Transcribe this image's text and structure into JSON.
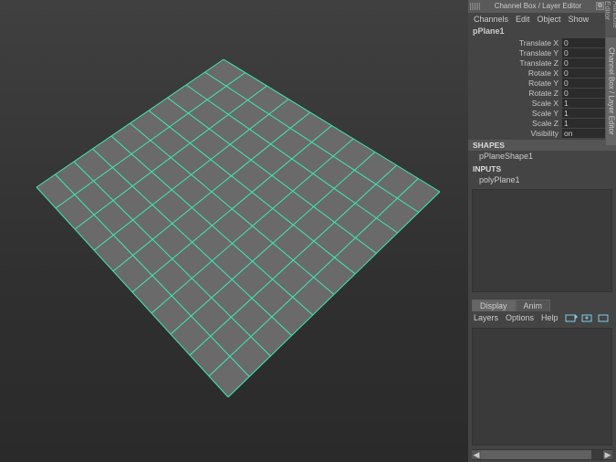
{
  "panel_title": "Channel Box / Layer Editor",
  "menus": {
    "channels": "Channels",
    "edit": "Edit",
    "object": "Object",
    "show": "Show"
  },
  "object_name": "pPlane1",
  "attrs": {
    "tx": {
      "label": "Translate X",
      "value": "0"
    },
    "ty": {
      "label": "Translate Y",
      "value": "0"
    },
    "tz": {
      "label": "Translate Z",
      "value": "0"
    },
    "rx": {
      "label": "Rotate X",
      "value": "0"
    },
    "ry": {
      "label": "Rotate Y",
      "value": "0"
    },
    "rz": {
      "label": "Rotate Z",
      "value": "0"
    },
    "sx": {
      "label": "Scale X",
      "value": "1"
    },
    "sy": {
      "label": "Scale Y",
      "value": "1"
    },
    "sz": {
      "label": "Scale Z",
      "value": "1"
    },
    "vis": {
      "label": "Visibility",
      "value": "on"
    }
  },
  "sections": {
    "shapes": "SHAPES",
    "shape_item": "pPlaneShape1",
    "inputs": "INPUTS",
    "input_item": "polyPlane1"
  },
  "tabs": {
    "display": "Display",
    "anim": "Anim"
  },
  "layer_menus": {
    "layers": "Layers",
    "options": "Options",
    "help": "Help"
  },
  "vtabs": {
    "attr": "Attribute Editor",
    "cb": "Channel Box / Layer Editor"
  },
  "colors": {
    "wire": "#3de9b4",
    "face": "#6a6a6a"
  },
  "scroll_arrows": {
    "left": "◀",
    "right": "▶"
  },
  "win_buttons": {
    "float": "⧉",
    "close": "✕"
  }
}
